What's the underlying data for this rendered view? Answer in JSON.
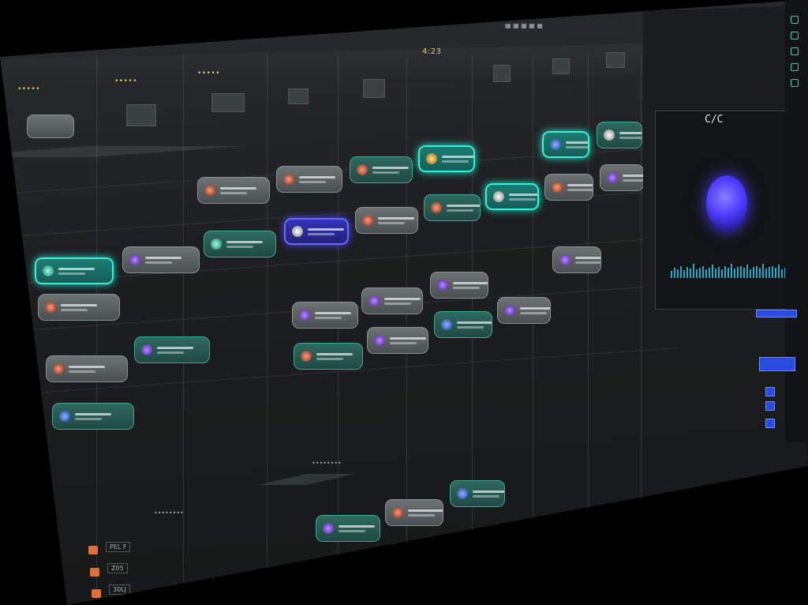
{
  "timeline": {
    "timecode": "4:23",
    "tracks": [
      "•••••",
      "•••••",
      "•••••"
    ],
    "section_labels": [
      "••••••••",
      "••••••••"
    ]
  },
  "viewer": {
    "title": "C/C",
    "bar_heights": [
      0.4,
      0.6,
      0.5,
      0.7,
      0.45,
      0.65,
      0.55,
      0.8,
      0.5,
      0.6,
      0.7,
      0.5,
      0.6,
      0.75,
      0.55,
      0.65,
      0.5,
      0.7,
      0.6,
      0.8,
      0.55,
      0.65,
      0.7,
      0.6,
      0.75,
      0.5,
      0.65,
      0.7,
      0.6,
      0.8,
      0.55,
      0.65,
      0.7,
      0.6,
      0.75,
      0.5,
      0.6,
      0.7,
      0.55,
      0.65
    ]
  },
  "colors": {
    "accent_teal": "#37f0d8",
    "accent_blue": "#4646ff",
    "tag_orange": "#e0703a"
  },
  "bottom_tracks": [
    "PEL F",
    "Z05",
    "30LJ"
  ]
}
